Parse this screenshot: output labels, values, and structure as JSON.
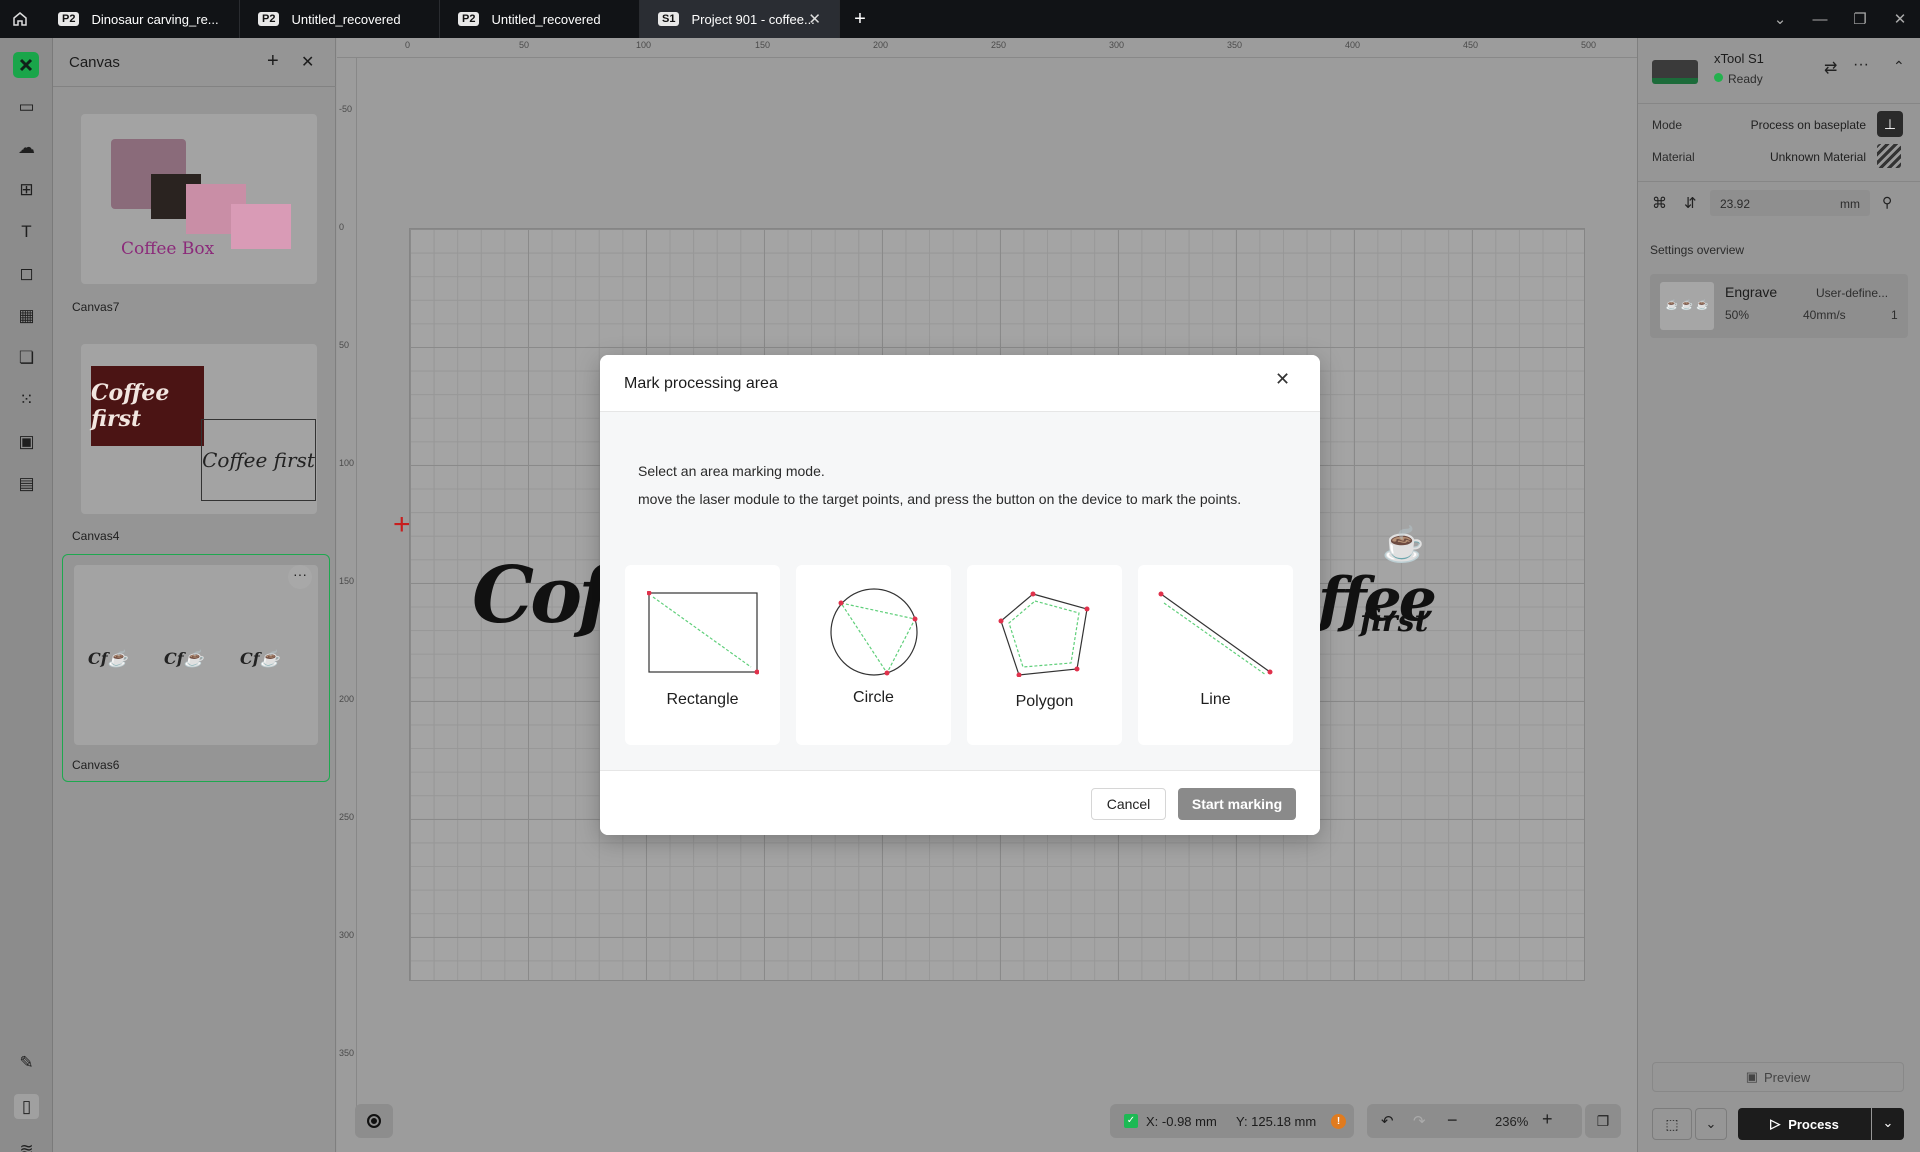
{
  "tabs": [
    {
      "badge": "P2",
      "title": "Dinosaur carving_re...",
      "active": false
    },
    {
      "badge": "P2",
      "title": "Untitled_recovered",
      "active": false
    },
    {
      "badge": "P2",
      "title": "Untitled_recovered",
      "active": false
    },
    {
      "badge": "S1",
      "title": "Project 901 - coffee...",
      "active": true
    }
  ],
  "canvas_panel": {
    "title": "Canvas",
    "items": [
      {
        "label": "Canvas7",
        "preview_text": "Coffee Box"
      },
      {
        "label": "Canvas4",
        "preview_text": "Coffee first"
      },
      {
        "label": "Canvas6",
        "preview_text": ""
      }
    ]
  },
  "ruler": {
    "top": [
      "0",
      "50",
      "100",
      "150",
      "200",
      "250",
      "300",
      "350",
      "400",
      "450",
      "500"
    ],
    "left": [
      "-50",
      "0",
      "50",
      "100",
      "150",
      "200",
      "250",
      "300",
      "350"
    ]
  },
  "device": {
    "name": "xTool S1",
    "status": "Ready",
    "mode_label": "Mode",
    "mode_value": "Process on baseplate",
    "material_label": "Material",
    "material_value": "Unknown Material",
    "height_value": "23.92",
    "height_unit": "mm"
  },
  "settings": {
    "title": "Settings overview",
    "process": "Engrave",
    "preset": "User-define...",
    "power": "50%",
    "speed": "40mm/s",
    "passes": "1"
  },
  "dialog": {
    "title": "Mark processing area",
    "line1": "Select an area marking mode.",
    "line2": "move the laser module to the target points, and press the button on the device to mark the points.",
    "modes": [
      "Rectangle",
      "Circle",
      "Polygon",
      "Line"
    ],
    "cancel": "Cancel",
    "start": "Start marking"
  },
  "status": {
    "x": "X: -0.98 mm",
    "y": "Y: 125.18 mm",
    "zoom": "236%"
  },
  "actions": {
    "preview": "Preview",
    "process": "Process"
  },
  "colors": {
    "accent": "#1db954",
    "dialog_point": "#e0314b",
    "dialog_arrow": "#5fcf7a",
    "status_ready": "#23b14d",
    "warning": "#e07b1f"
  }
}
